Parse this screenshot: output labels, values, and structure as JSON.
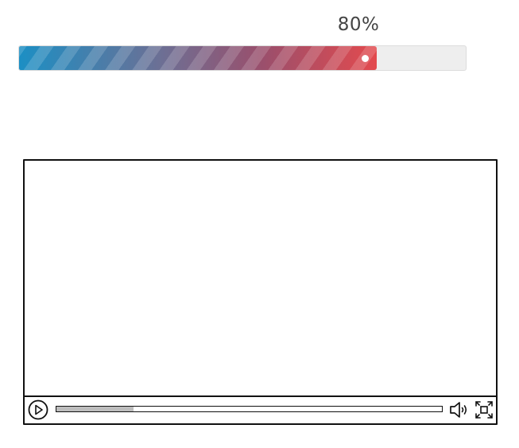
{
  "progress": {
    "label": "80%",
    "value_fraction": 0.8,
    "colors": {
      "start": "#1c8fc4",
      "end": "#e34a4e",
      "track": "#eeeeee"
    }
  },
  "video_player": {
    "seek_played_fraction": 0.2,
    "controls": {
      "play_icon": "play-icon",
      "volume_icon": "volume-icon",
      "fullscreen_icon": "fullscreen-icon"
    }
  }
}
